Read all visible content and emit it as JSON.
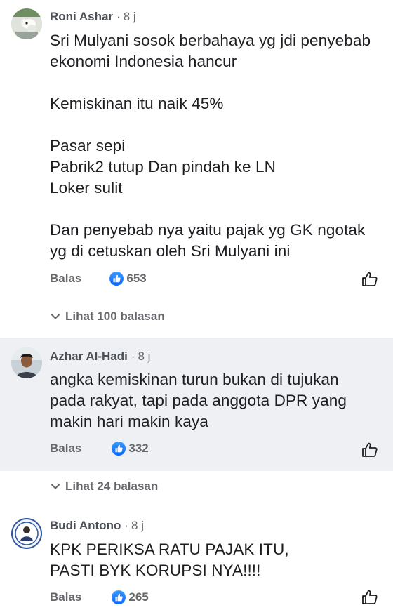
{
  "comments": [
    {
      "author": "Roni Ashar",
      "time": "8 j",
      "avatar_icon": "profile-photo",
      "text": "Sri Mulyani sosok berbahaya yg jdi penyebab\nekonomi Indonesia hancur\n\nKemiskinan itu naik 45%\n\nPasar sepi\nPabrik2 tutup Dan pindah ke LN\nLoker sulit\n\nDan penyebab nya yaitu pajak yg GK ngotak\nyg di cetuskan oleh Sri Mulyani ini",
      "reply_label": "Balas",
      "like_count": "653",
      "view_replies": "Lihat 100 balasan"
    },
    {
      "author": "Azhar Al-Hadi",
      "time": "8 j",
      "avatar_icon": "profile-photo",
      "text": "angka kemiskinan turun bukan di tujukan\npada rakyat, tapi pada anggota DPR yang\nmakin hari makin kaya",
      "reply_label": "Balas",
      "like_count": "332",
      "view_replies": "Lihat 24 balasan"
    },
    {
      "author": "Budi Antono",
      "time": "8 j",
      "avatar_icon": "profile-photo",
      "text": "KPK PERIKSA RATU PAJAK ITU,\nPASTI BYK KORUPSI NYA!!!!",
      "reply_label": "Balas",
      "like_count": "265"
    }
  ],
  "colors": {
    "like_blue": "#0866ff",
    "muted_text": "#65676b",
    "highlight_bg": "#eef0f3"
  }
}
